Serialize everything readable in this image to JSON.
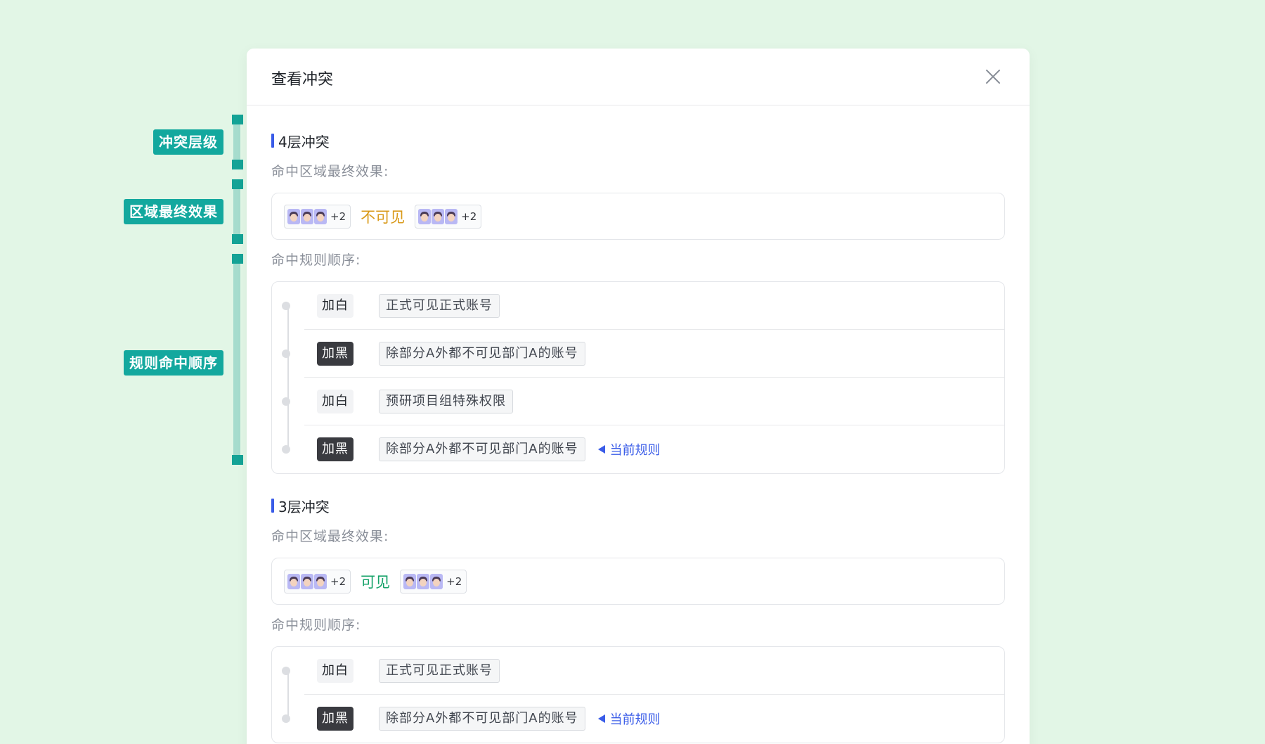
{
  "annotations": {
    "conflict_level": "冲突层级",
    "region_effect": "区域最终效果",
    "rule_order": "规则命中顺序"
  },
  "modal": {
    "title": "查看冲突",
    "close_icon": "close-icon"
  },
  "labels": {
    "final_effect": "命中区域最终效果:",
    "rule_order": "命中规则顺序:",
    "current_rule": "当前规则"
  },
  "colors": {
    "accent": "#3a5ce8",
    "invisible": "#d99a1a",
    "visible": "#17a36a",
    "annotation": "#13a89e"
  },
  "sections": [
    {
      "title": "4层冲突",
      "effect": {
        "left_avatars_more": "+2",
        "text": "不可见",
        "right_avatars_more": "+2"
      },
      "rules": [
        {
          "action": "加白",
          "name": "正式可见正式账号",
          "current": false
        },
        {
          "action": "加黑",
          "name": "除部分A外都不可见部门A的账号",
          "current": false
        },
        {
          "action": "加白",
          "name": "预研项目组特殊权限",
          "current": false
        },
        {
          "action": "加黑",
          "name": "除部分A外都不可见部门A的账号",
          "current": true
        }
      ]
    },
    {
      "title": "3层冲突",
      "effect": {
        "left_avatars_more": "+2",
        "text": "可见",
        "right_avatars_more": "+2"
      },
      "rules": [
        {
          "action": "加白",
          "name": "正式可见正式账号",
          "current": false
        },
        {
          "action": "加黑",
          "name": "除部分A外都不可见部门A的账号",
          "current": true
        }
      ]
    }
  ]
}
